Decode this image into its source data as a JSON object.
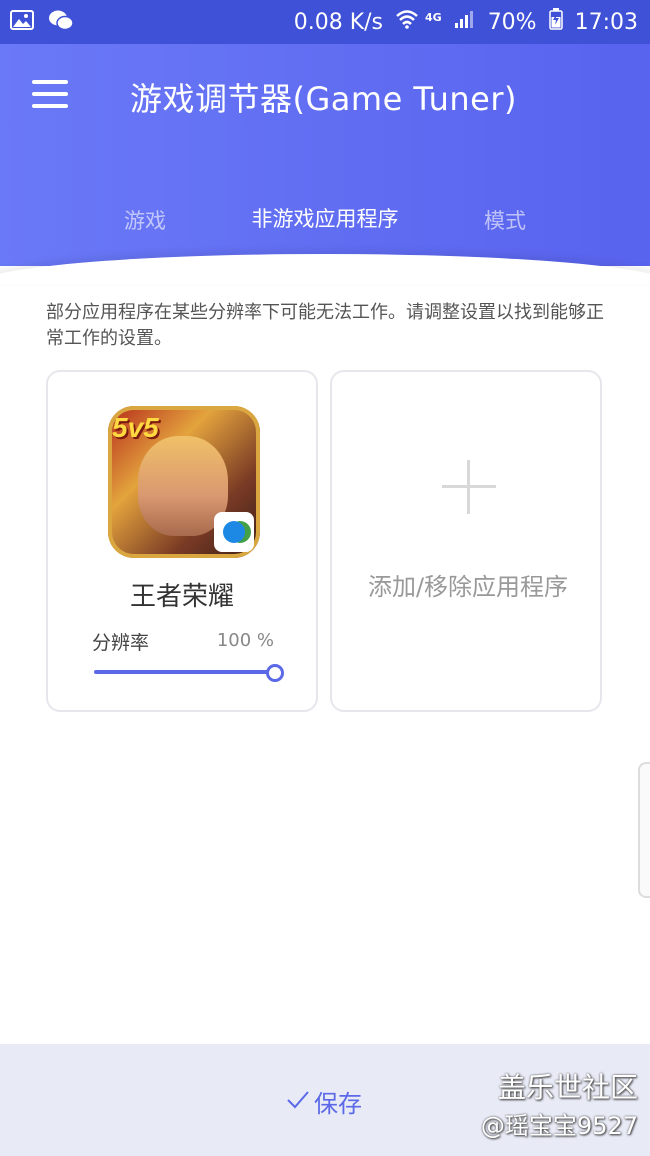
{
  "status_bar": {
    "left_icons": [
      "gallery-icon",
      "wechat-icon"
    ],
    "speed": "0.08 K/s",
    "network": "4G",
    "battery": "70%",
    "time": "17:03"
  },
  "header": {
    "title": "游戏调节器(Game Tuner)"
  },
  "tabs": [
    {
      "label": "游戏",
      "active": false
    },
    {
      "label": "非游戏应用程序",
      "active": true
    },
    {
      "label": "模式",
      "active": false
    }
  ],
  "description": "部分应用程序在某些分辨率下可能无法工作。请调整设置以找到能够正常工作的设置。",
  "app_card": {
    "icon_tag": "5v5",
    "name": "王者荣耀",
    "resolution_label": "分辨率",
    "resolution_value": "100 %",
    "resolution_fraction": 1.0
  },
  "add_card": {
    "label": "添加/移除应用程序"
  },
  "footer": {
    "save_label": "保存"
  },
  "watermark": {
    "line1": "盖乐世社区",
    "line2": "@瑶宝宝9527"
  },
  "colors": {
    "accent": "#5b69e8",
    "header_start": "#6a79f7",
    "header_end": "#5863ee",
    "status_bar": "#3f51d6"
  }
}
